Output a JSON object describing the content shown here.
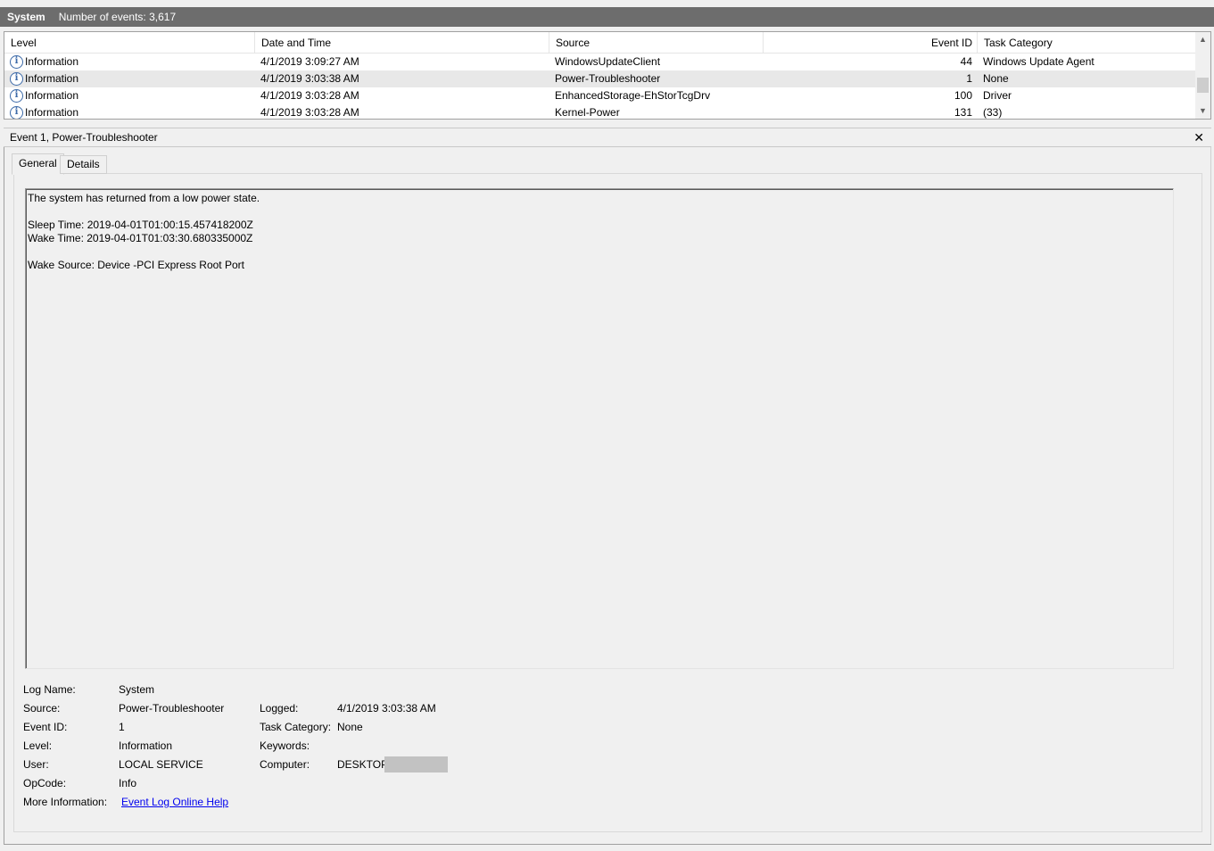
{
  "titlebar": {
    "log_name": "System",
    "event_count": "Number of events: 3,617"
  },
  "grid": {
    "columns": [
      "Level",
      "Date and Time",
      "Source",
      "Event ID",
      "Task Category"
    ],
    "rows": [
      {
        "level": "Information",
        "datetime": "4/1/2019 3:09:27 AM",
        "source": "WindowsUpdateClient",
        "event_id": "44",
        "task_category": "Windows Update Agent"
      },
      {
        "level": "Information",
        "datetime": "4/1/2019 3:03:38 AM",
        "source": "Power-Troubleshooter",
        "event_id": "1",
        "task_category": "None"
      },
      {
        "level": "Information",
        "datetime": "4/1/2019 3:03:28 AM",
        "source": "EnhancedStorage-EhStorTcgDrv",
        "event_id": "100",
        "task_category": "Driver"
      },
      {
        "level": "Information",
        "datetime": "4/1/2019 3:03:28 AM",
        "source": "Kernel-Power",
        "event_id": "131",
        "task_category": "(33)"
      }
    ],
    "selected_row": 1
  },
  "detail": {
    "header": "Event 1, Power-Troubleshooter",
    "close": "✕",
    "tabs": [
      "General",
      "Details"
    ],
    "description": "The system has returned from a low power state.\n\nSleep Time: 2019-04-01T01:00:15.457418200Z\nWake Time: 2019-04-01T01:03:30.680335000Z\n\nWake Source: Device -PCI Express Root Port",
    "props": {
      "log_name_label": "Log Name:",
      "log_name": "System",
      "source_label": "Source:",
      "source": "Power-Troubleshooter",
      "logged_label": "Logged:",
      "logged": "4/1/2019 3:03:38 AM",
      "event_id_label": "Event ID:",
      "event_id": "1",
      "task_category_label": "Task Category:",
      "task_category": "None",
      "level_label": "Level:",
      "level": "Information",
      "keywords_label": "Keywords:",
      "user_label": "User:",
      "user": "LOCAL SERVICE",
      "computer_label": "Computer:",
      "computer": "DESKTOP-",
      "opcode_label": "OpCode:",
      "opcode": "Info",
      "more_info_label": "More Information:",
      "more_info_link": "Event Log Online Help"
    }
  }
}
